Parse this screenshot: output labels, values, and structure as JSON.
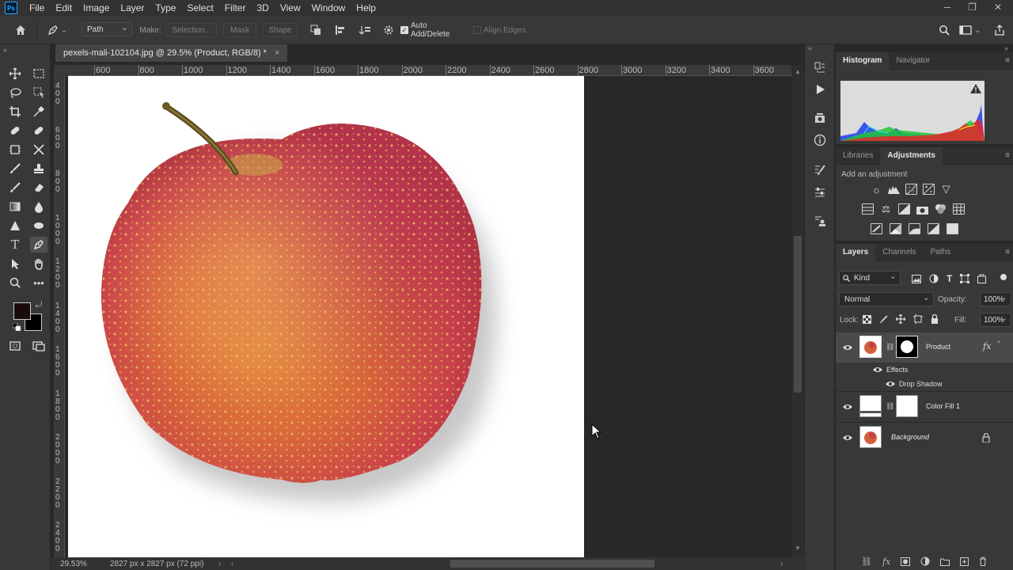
{
  "app": {
    "logo": "Ps"
  },
  "menu": [
    "File",
    "Edit",
    "Image",
    "Layer",
    "Type",
    "Select",
    "Filter",
    "3D",
    "View",
    "Window",
    "Help"
  ],
  "window_controls": {
    "minimize": "─",
    "restore": "❐",
    "close": "✕"
  },
  "options": {
    "tool_mode": "Path",
    "make_label": "Make:",
    "selection_btn": "Selection...",
    "mask_btn": "Mask",
    "shape_btn": "Shape",
    "auto_add_delete": "Auto Add/Delete",
    "auto_add_checked": true,
    "align_edges": "Align Edges"
  },
  "document": {
    "tab_title": "pexels-mali-102104.jpg @ 29.5% (Product, RGB/8) *",
    "tab_close": "×",
    "zoom": "29.53%",
    "dimensions": "2827 px x 2827 px (72 ppi)"
  },
  "ruler_h": [
    "600",
    "800",
    "1000",
    "1200",
    "1400",
    "1600",
    "1800",
    "2000",
    "2200",
    "2400",
    "2600",
    "2800",
    "3000",
    "3200",
    "3400",
    "3600"
  ],
  "ruler_v": [
    "4\n0\n0",
    "6\n0\n0",
    "8\n0\n0",
    "1\n0\n0\n0",
    "1\n2\n0\n0",
    "1\n4\n0\n0",
    "1\n6\n0\n0",
    "1\n8\n0\n0",
    "2\n0\n0\n0",
    "2\n2\n0\n0",
    "2\n4\n0\n0"
  ],
  "panels": {
    "top_tabs": [
      "Histogram",
      "Navigator"
    ],
    "mid_tabs": [
      "Libraries",
      "Adjustments"
    ],
    "add_adjustment": "Add an adjustment",
    "layers_tabs": [
      "Layers",
      "Channels",
      "Paths"
    ],
    "filter_kind": "Kind",
    "blend_mode": "Normal",
    "opacity_label": "Opacity:",
    "opacity_value": "100%",
    "lock_label": "Lock:",
    "fill_label": "Fill:",
    "fill_value": "100%"
  },
  "layers": [
    {
      "name": "Product",
      "fx": "fx",
      "effects_label": "Effects",
      "effect": "Drop Shadow"
    },
    {
      "name": "Color Fill 1"
    },
    {
      "name": "Background"
    }
  ],
  "colors": {
    "accent": "#31a8ff",
    "foreground": "#1a0a08",
    "background": "#000000",
    "panel": "#383838",
    "canvas_bg": "#282828"
  }
}
